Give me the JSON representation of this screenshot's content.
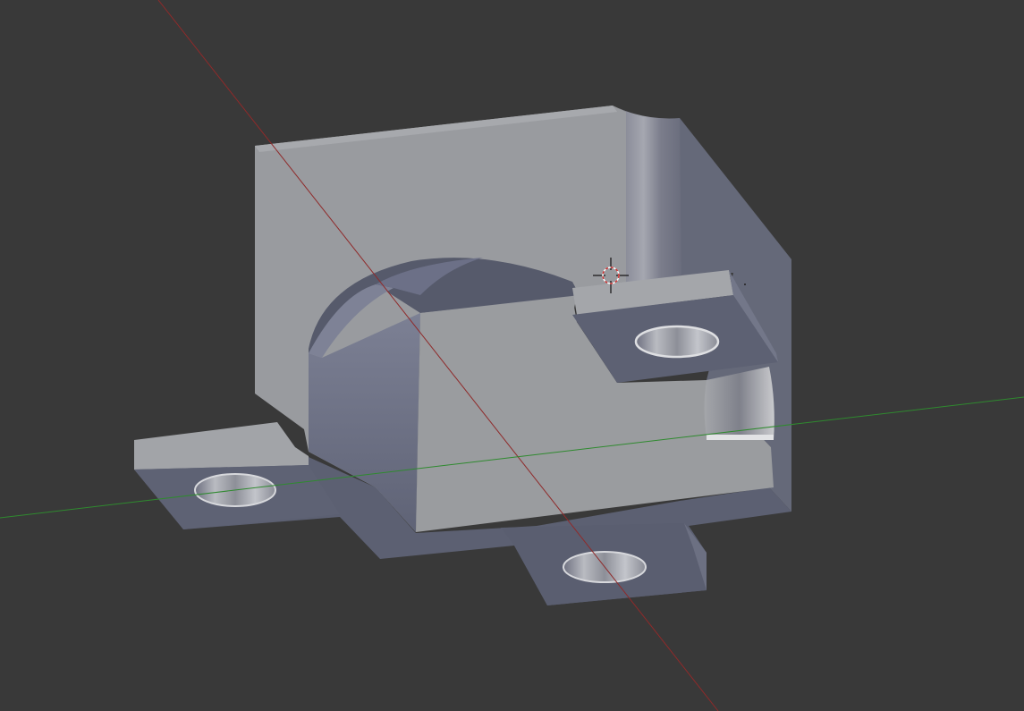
{
  "app": {
    "view": "3d-viewport"
  },
  "viewport": {
    "background_color": "#393939",
    "axes": {
      "x_axis_color": "#8f2a2a",
      "y_axis_color": "#2f8a2f"
    },
    "cursor": {
      "icon": "3d-cursor-icon",
      "ring_color_a": "#cc3333",
      "ring_color_b": "#ffffff"
    },
    "model": {
      "name": "",
      "colors": {
        "light_face": "#9a9ca0",
        "mid_face": "#8a8c98",
        "dark_face": "#636779",
        "shadow_face": "#545869",
        "hole_light": "#b8bac0",
        "hole_dark": "#7a7c86",
        "top_edge": "#a9abaf"
      }
    }
  }
}
